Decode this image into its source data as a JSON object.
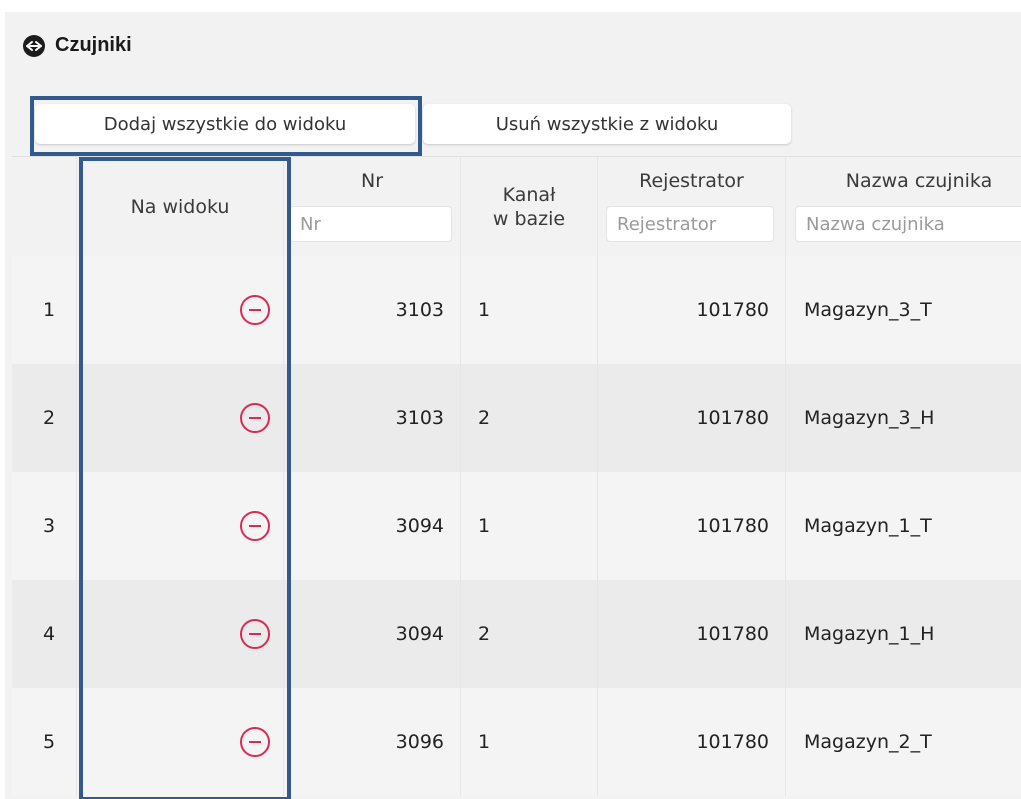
{
  "header": {
    "title": "Czujniki",
    "icon": "sensor-icon"
  },
  "toolbar": {
    "add_all_label": "Dodaj wszystkie do widoku",
    "remove_all_label": "Usuń wszystkie z widoku"
  },
  "table": {
    "columns": {
      "na_widoku": "Na widoku",
      "nr": "Nr",
      "kanal_line1": "Kanał",
      "kanal_line2": "w bazie",
      "rejestrator": "Rejestrator",
      "nazwa": "Nazwa czujnika"
    },
    "filters": {
      "nr_placeholder": "Nr",
      "rejestrator_placeholder": "Rejestrator",
      "nazwa_placeholder": "Nazwa czujnika"
    },
    "rows": [
      {
        "index": "1",
        "nr": "3103",
        "kanal": "1",
        "rejestrator": "101780",
        "nazwa": "Magazyn_3_T"
      },
      {
        "index": "2",
        "nr": "3103",
        "kanal": "2",
        "rejestrator": "101780",
        "nazwa": "Magazyn_3_H"
      },
      {
        "index": "3",
        "nr": "3094",
        "kanal": "1",
        "rejestrator": "101780",
        "nazwa": "Magazyn_1_T"
      },
      {
        "index": "4",
        "nr": "3094",
        "kanal": "2",
        "rejestrator": "101780",
        "nazwa": "Magazyn_1_H"
      },
      {
        "index": "5",
        "nr": "3096",
        "kanal": "1",
        "rejestrator": "101780",
        "nazwa": "Magazyn_2_T"
      }
    ]
  },
  "colors": {
    "highlight_border": "#325a8c",
    "remove_icon": "#d82a52",
    "panel_background": "#f2f2f2"
  }
}
